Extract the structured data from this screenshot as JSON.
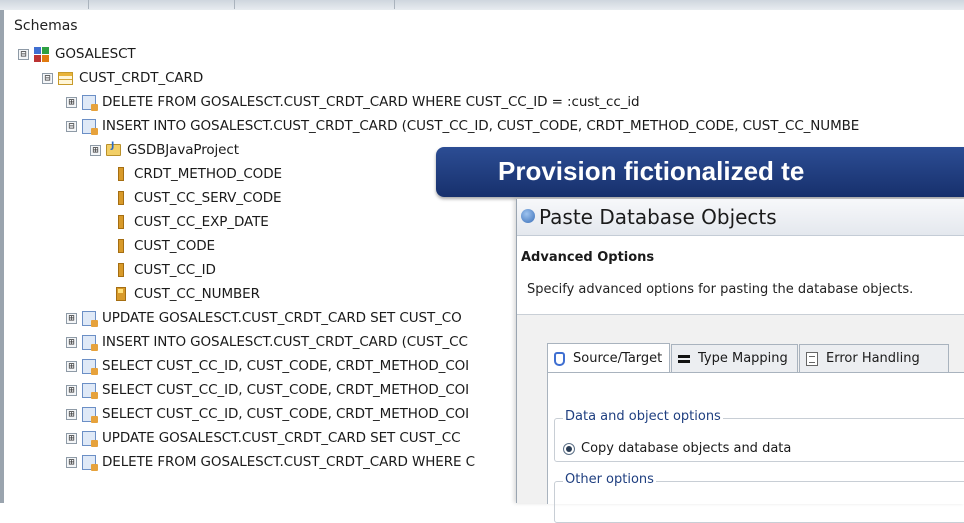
{
  "tree": {
    "header": "Schemas",
    "schema": {
      "label": "GOSALESCT",
      "toggle": "⊟"
    },
    "table": {
      "label": "CUST_CRDT_CARD",
      "toggle": "⊟"
    },
    "statements": [
      {
        "label": "DELETE FROM GOSALESCT.CUST_CRDT_CARD WHERE CUST_CC_ID = :cust_cc_id",
        "toggle": "⊞"
      },
      {
        "label": "INSERT INTO GOSALESCT.CUST_CRDT_CARD (CUST_CC_ID, CUST_CODE, CRDT_METHOD_CODE,  CUST_CC_NUMBE",
        "toggle": "⊟"
      }
    ],
    "project": {
      "label": "GSDBJavaProject",
      "toggle": "⊞"
    },
    "columns": [
      {
        "label": "CRDT_METHOD_CODE",
        "icon": "column-icon"
      },
      {
        "label": "CUST_CC_SERV_CODE",
        "icon": "column-icon"
      },
      {
        "label": "CUST_CC_EXP_DATE",
        "icon": "column-icon"
      },
      {
        "label": "CUST_CODE",
        "icon": "column-icon"
      },
      {
        "label": "CUST_CC_ID",
        "icon": "column-icon"
      },
      {
        "label": "CUST_CC_NUMBER",
        "icon": "primary-key-column-icon"
      }
    ],
    "more_statements": [
      {
        "label": "UPDATE GOSALESCT.CUST_CRDT_CARD  SET CUST_CO",
        "toggle": "⊞"
      },
      {
        "label": "INSERT INTO GOSALESCT.CUST_CRDT_CARD (CUST_CC",
        "toggle": "⊞"
      },
      {
        "label": "SELECT CUST_CC_ID, CUST_CODE, CRDT_METHOD_COI",
        "toggle": "⊞"
      },
      {
        "label": "SELECT CUST_CC_ID, CUST_CODE, CRDT_METHOD_COI",
        "toggle": "⊞"
      },
      {
        "label": "SELECT CUST_CC_ID, CUST_CODE, CRDT_METHOD_COI",
        "toggle": "⊞"
      },
      {
        "label": "UPDATE GOSALESCT.CUST_CRDT_CARD  SET CUST_CC",
        "toggle": "⊞"
      },
      {
        "label": "DELETE FROM GOSALESCT.CUST_CRDT_CARD WHERE C",
        "toggle": "⊞"
      }
    ]
  },
  "banner": {
    "text": "Provision fictionalized te"
  },
  "dialog": {
    "title": "Paste Database Objects",
    "heading": "Advanced Options",
    "description": "Specify advanced options for pasting the database objects.",
    "tabs": [
      {
        "label": "Source/Target",
        "icon": "database-icon",
        "active": true
      },
      {
        "label": "Type Mapping",
        "icon": "mapping-icon",
        "active": false
      },
      {
        "label": "Error Handling",
        "icon": "document-icon",
        "active": false
      }
    ],
    "data_options": {
      "group_label": "Data and object options",
      "radio_label": "Copy database objects and data",
      "selected": true
    },
    "other_options": {
      "group_label": "Other options"
    }
  },
  "colors": {
    "banner_bg": "#1f3c7f",
    "banner_text": "#ffffff",
    "group_label": "#1f3f80"
  }
}
